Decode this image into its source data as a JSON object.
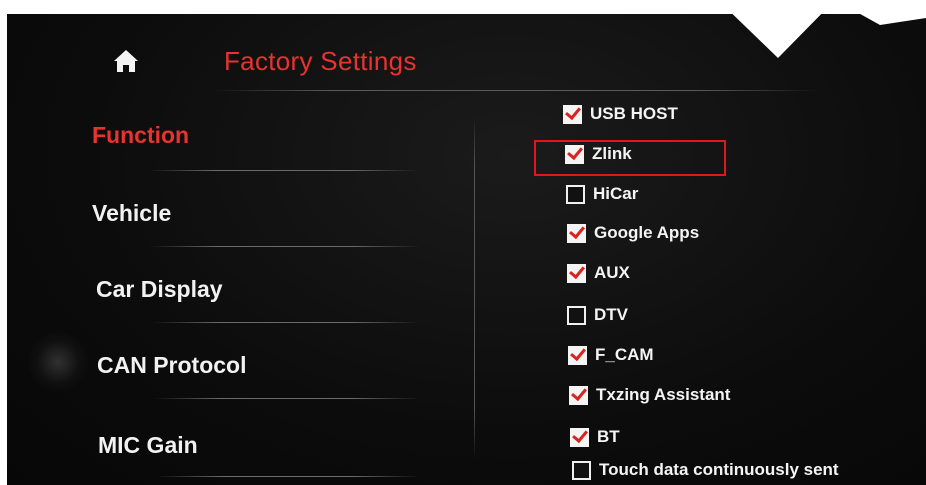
{
  "header": {
    "title": "Factory Settings",
    "home_icon": "home-icon"
  },
  "sidebar": {
    "items": [
      {
        "label": "Function",
        "active": true
      },
      {
        "label": "Vehicle",
        "active": false
      },
      {
        "label": "Car Display",
        "active": false
      },
      {
        "label": "CAN Protocol",
        "active": false
      },
      {
        "label": "MIC Gain",
        "active": false
      }
    ]
  },
  "options": [
    {
      "label": "USB HOST",
      "checked": true
    },
    {
      "label": "Zlink",
      "checked": true,
      "highlighted": true
    },
    {
      "label": "HiCar",
      "checked": false
    },
    {
      "label": "Google Apps",
      "checked": true
    },
    {
      "label": "AUX",
      "checked": true
    },
    {
      "label": "DTV",
      "checked": false
    },
    {
      "label": "F_CAM",
      "checked": true
    },
    {
      "label": "Txzing Assistant",
      "checked": true
    },
    {
      "label": "BT",
      "checked": true
    },
    {
      "label": "Touch data continuously sent",
      "checked": false
    }
  ],
  "colors": {
    "accent": "#e8332e",
    "text": "#f2f2f2",
    "background": "#0c0c0c",
    "highlight_box": "#e2161b"
  }
}
